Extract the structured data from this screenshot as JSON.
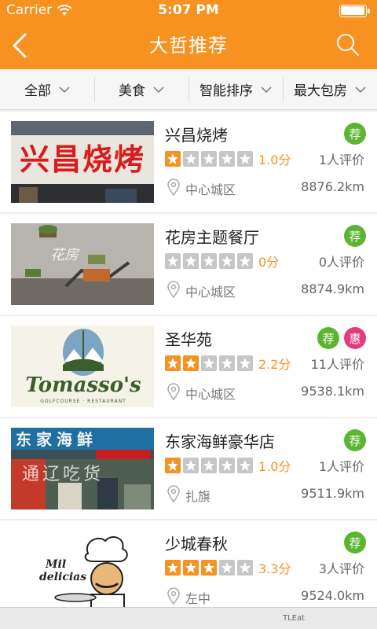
{
  "status_bar": {
    "carrier": "Carrier",
    "time": "5:07 PM"
  },
  "nav": {
    "title": "大哲推荐",
    "back_icon": "back-arrow-icon",
    "search_icon": "search-icon"
  },
  "filters": [
    {
      "label": "全部"
    },
    {
      "label": "美食"
    },
    {
      "label": "智能排序"
    },
    {
      "label": "最大包房"
    }
  ],
  "colors": {
    "accent": "#f7911f",
    "recommend_badge": "#5cb531",
    "discount_badge": "#e23c7c",
    "star_off": "#c7c7c7"
  },
  "restaurants": [
    {
      "name": "兴昌烧烤",
      "rating": 1,
      "score": "1.0分",
      "reviews": "1人评价",
      "district": "中心城区",
      "distance": "8876.2km",
      "badges": [
        "荐"
      ]
    },
    {
      "name": "花房主题餐厅",
      "rating": 0,
      "score": "0分",
      "reviews": "0人评价",
      "district": "中心城区",
      "distance": "8874.9km",
      "badges": [
        "荐"
      ]
    },
    {
      "name": "圣华苑",
      "rating": 2,
      "score": "2.2分",
      "reviews": "11人评价",
      "district": "中心城区",
      "distance": "9538.1km",
      "badges": [
        "荐",
        "惠"
      ]
    },
    {
      "name": "东家海鲜豪华店",
      "rating": 1,
      "score": "1.0分",
      "reviews": "1人评价",
      "district": "扎旗",
      "distance": "9511.9km",
      "badges": [
        "荐"
      ]
    },
    {
      "name": "少城春秋",
      "rating": 3,
      "score": "3.3分",
      "reviews": "3人评价",
      "district": "左中",
      "distance": "9524.0km",
      "badges": [
        "荐"
      ]
    }
  ],
  "photo_texts": {
    "sign_1": "兴昌烧烤",
    "sign_2": "花房",
    "logo_3_main": "Tomasso's",
    "logo_3_sub": "GOLFCOURSE · RESTAURANT",
    "sign_4": "东家海鲜",
    "watermark_4": "通辽吃货",
    "logo_5": "Mil delicias"
  },
  "bottom_peek": {
    "label": "TLEat"
  }
}
